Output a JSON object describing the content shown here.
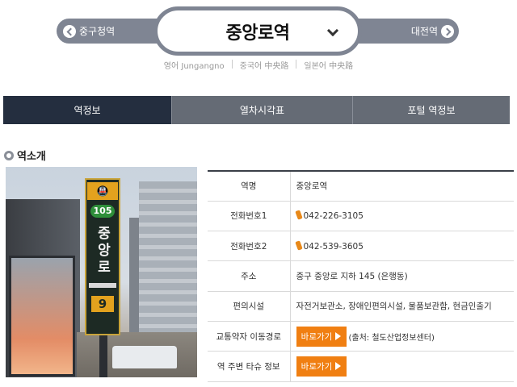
{
  "station_nav": {
    "prev_station": "중구청역",
    "current_station": "중앙로역",
    "next_station": "대전역",
    "translations": [
      "영어 Jungangno",
      "중국어 中央路",
      "일본어 中央路"
    ]
  },
  "tabs": [
    {
      "label": "역정보",
      "active": true
    },
    {
      "label": "열차시각표",
      "active": false
    },
    {
      "label": "포털 역정보",
      "active": false
    }
  ],
  "section": {
    "title": "역소개"
  },
  "photo": {
    "sign_line_number": "105",
    "sign_station": "중앙로",
    "sign_exit": "9"
  },
  "info": {
    "rows": [
      {
        "label": "역명",
        "value": "중앙로역"
      },
      {
        "label": "전화번호1",
        "value": "042-226-3105"
      },
      {
        "label": "전화번호2",
        "value": "042-539-3605"
      },
      {
        "label": "주소",
        "value": "중구 중앙로 지하 145 (은행동)"
      },
      {
        "label": "편의시설",
        "value": "자전거보관소, 장애인편의시설, 물품보관함, 현금인출기"
      },
      {
        "label": "교통약자 이동경로",
        "button": "바로가기",
        "note": "(출처: 철도산업정보센터)"
      },
      {
        "label": "역 주변 타슈 정보",
        "button": "바로가기"
      }
    ]
  },
  "colors": {
    "nav_gray": "#7f8593",
    "tab_active": "#242e3f",
    "tab_inactive": "#656b75",
    "button_orange": "#f07f12"
  }
}
